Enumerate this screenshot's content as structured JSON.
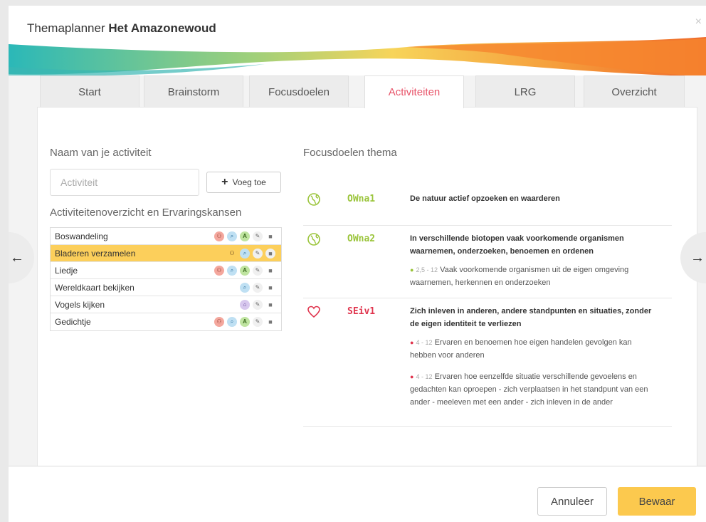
{
  "modal": {
    "title_prefix": "Themaplanner ",
    "title_bold": "Het Amazonewoud",
    "close_glyph": "×"
  },
  "tabs": [
    {
      "label": "Start",
      "active": false
    },
    {
      "label": "Brainstorm",
      "active": false
    },
    {
      "label": "Focusdoelen",
      "active": false
    },
    {
      "label": "Activiteiten",
      "active": true
    },
    {
      "label": "LRG",
      "active": false
    },
    {
      "label": "Overzicht",
      "active": false
    }
  ],
  "left": {
    "name_label": "Naam van je activiteit",
    "input_placeholder": "Activiteit",
    "add_button": "Voeg toe",
    "list_label": "Activiteitenoverzicht en Ervaringskansen",
    "activities": [
      {
        "label": "Boswandeling",
        "selected": false,
        "icons": [
          "people",
          "search",
          "a"
        ]
      },
      {
        "label": "Bladeren verzamelen",
        "selected": true,
        "icons": [
          "people",
          "search"
        ]
      },
      {
        "label": "Liedje",
        "selected": false,
        "icons": [
          "people",
          "search",
          "a"
        ]
      },
      {
        "label": "Wereldkaart bekijken",
        "selected": false,
        "icons": [
          "search"
        ]
      },
      {
        "label": "Vogels kijken",
        "selected": false,
        "icons": [
          "house"
        ]
      },
      {
        "label": "Gedichtje",
        "selected": false,
        "icons": [
          "people",
          "search",
          "a"
        ]
      }
    ]
  },
  "right": {
    "heading": "Focusdoelen thema",
    "goals": [
      {
        "code": "OWna1",
        "text": "De natuur actief opzoeken en waarderen",
        "icon": "globe-icon"
      },
      {
        "code": "OWna2",
        "text": "In verschillende biotopen vaak voorkomende organismen waarnemen, onderzoeken, benoemen en ordenen",
        "icon": "globe-icon",
        "subs": [
          {
            "range": "2,5 - 12",
            "text": "Vaak voorkomende organismen uit de eigen omgeving waarnemen, herkennen en onderzoeken"
          }
        ]
      },
      {
        "code": "SEiv1",
        "text": "Zich inleven in anderen, andere standpunten en situaties, zonder de eigen identiteit te verliezen",
        "icon": "heart-icon",
        "subs": [
          {
            "range": "4 - 12",
            "text": "Ervaren en benoemen hoe eigen handelen gevolgen kan hebben voor anderen"
          },
          {
            "range": "4 - 12",
            "text": "Ervaren hoe eenzelfde situatie verschillende gevoelens en gedachten kan oproepen - zich verplaatsen in het standpunt van een ander - meeleven met een ander - zich inleven in de ander"
          }
        ]
      }
    ]
  },
  "nav": {
    "prev": "←",
    "next": "→"
  },
  "footer": {
    "cancel": "Annuleer",
    "save": "Bewaar"
  },
  "colors": {
    "accent_red": "#e8556a",
    "owna_green": "#9ac43a",
    "seiv_red": "#e0344d",
    "selected_yellow": "#fccf5b",
    "save_yellow": "#fcc94e"
  }
}
